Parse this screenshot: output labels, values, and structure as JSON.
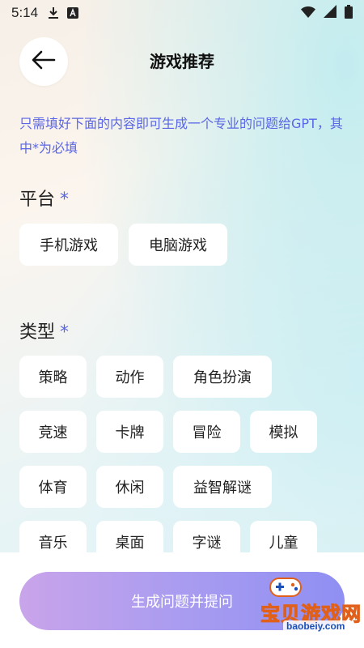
{
  "status_bar": {
    "time": "5:14",
    "icons": [
      "download-icon",
      "font-a-icon",
      "wifi-icon",
      "cell-signal-icon",
      "battery-icon"
    ]
  },
  "header": {
    "title": "游戏推荐",
    "back_icon": "arrow-left-icon"
  },
  "intro": "只需填好下面的内容即可生成一个专业的问题给GPT，其中*为必填",
  "platform": {
    "title": "平台",
    "required_mark": "*",
    "options": [
      "手机游戏",
      "电脑游戏"
    ]
  },
  "genre": {
    "title": "类型",
    "required_mark": "*",
    "options": [
      "策略",
      "动作",
      "角色扮演",
      "竞速",
      "卡牌",
      "冒险",
      "模拟",
      "体育",
      "休闲",
      "益智解谜",
      "音乐",
      "桌面",
      "字谜",
      "儿童"
    ]
  },
  "submit": {
    "label": "生成问题并提问"
  },
  "watermark": {
    "text": "宝贝游戏网",
    "url": "baobeiy.com"
  },
  "colors": {
    "accent": "#5a66e6",
    "chip_bg": "#ffffff",
    "button_gradient_start": "#c9a4ea",
    "button_gradient_end": "#8f8ff3"
  }
}
